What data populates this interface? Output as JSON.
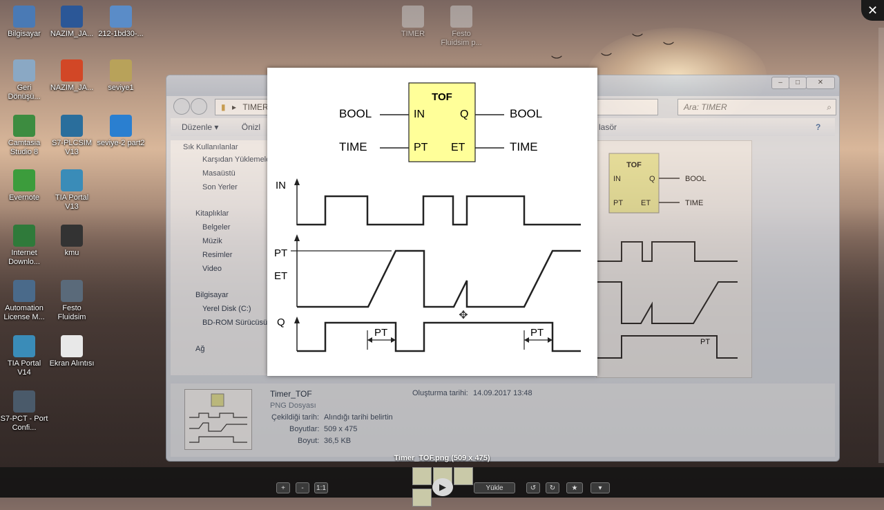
{
  "desktop": {
    "icons": [
      {
        "label": "Bilgisayar",
        "icon": "computer-icon",
        "color": "#4a7ab5"
      },
      {
        "label": "NAZIM_JA...",
        "icon": "word-doc-icon",
        "color": "#2b5797"
      },
      {
        "label": "212-1bd30-...",
        "icon": "document-icon",
        "color": "#5a8cc8"
      },
      {
        "label": "TIMER",
        "icon": "folder-icon",
        "color": "#c8c8c8"
      },
      {
        "label": "Festo Fluidsim p...",
        "icon": "folder-icon",
        "color": "#c8c8c8"
      },
      {
        "label": "Geri Dönüşü...",
        "icon": "recycle-bin-icon",
        "color": "#8aa8c4"
      },
      {
        "label": "NAZIM_JA...",
        "icon": "pdf-icon",
        "color": "#d24726"
      },
      {
        "label": "seviye1",
        "icon": "archive-icon",
        "color": "#b8a25a"
      },
      {
        "label": "Camtasia Studio 8",
        "icon": "camtasia-icon",
        "color": "#3d8c40"
      },
      {
        "label": "S7-PLCSIM V13",
        "icon": "plcsim-icon",
        "color": "#2a6e9c"
      },
      {
        "label": "seviye-2 part2",
        "icon": "lightning-icon",
        "color": "#2a7fd0"
      },
      {
        "label": "Evernote",
        "icon": "evernote-icon",
        "color": "#3c9c3c"
      },
      {
        "label": "TIA Portal V13",
        "icon": "tia-portal-icon",
        "color": "#3a8cb8"
      },
      {
        "label": "Internet Downlo...",
        "icon": "internet-download-icon",
        "color": "#2f7a3a"
      },
      {
        "label": "kmu",
        "icon": "image-icon",
        "color": "#333333"
      },
      {
        "label": "Automation License M...",
        "icon": "license-icon",
        "color": "#4a6a8a"
      },
      {
        "label": "Festo Fluidsim",
        "icon": "fluidsim-icon",
        "color": "#5a6a7a"
      },
      {
        "label": "TIA Portal V14",
        "icon": "tia-portal-icon",
        "color": "#3a8cb8"
      },
      {
        "label": "Ekran Alıntısı",
        "icon": "snipping-tool-icon",
        "color": "#e8e8e8"
      },
      {
        "label": "S7-PCT - Port Confi...",
        "icon": "s7-pct-icon",
        "color": "#4a5a6a"
      }
    ]
  },
  "explorer": {
    "address": "TIMER",
    "search_placeholder": "Ara: TIMER",
    "toolbar": {
      "organize": "Düzenle",
      "preview": "Önizl",
      "slideshow": "lasör"
    },
    "sidebar": {
      "favorites_header": "Sık Kullanılanlar",
      "favorites": [
        "Karşıdan Yüklemeler",
        "Masaüstü",
        "Son Yerler"
      ],
      "libraries_header": "Kitaplıklar",
      "libraries": [
        "Belgeler",
        "Müzik",
        "Resimler",
        "Video"
      ],
      "computer_header": "Bilgisayar",
      "computer": [
        "Yerel Disk (C:)",
        "BD-ROM Sürücüsü"
      ],
      "network": "Ağ"
    },
    "details": {
      "filename": "Timer_TOF",
      "filetype": "PNG Dosyası",
      "date_taken_label": "Çekildiği tarih:",
      "date_taken_value": "Alındığı tarihi belirtin",
      "dimensions_label": "Boyutlar:",
      "dimensions_value": "509 x 475",
      "size_label": "Boyut:",
      "size_value": "36,5 KB",
      "created_label": "Oluşturma tarihi:",
      "created_value": "14.09.2017 13:48"
    },
    "preview_pane": {
      "block_title": "TOF",
      "in": "IN",
      "pt": "PT",
      "q": "Q",
      "et": "ET",
      "bool": "BOOL",
      "time": "TIME",
      "pt_marker": "PT"
    }
  },
  "viewer": {
    "block_title": "TOF",
    "input_in": "IN",
    "input_pt": "PT",
    "output_q": "Q",
    "output_et": "ET",
    "left_in_type": "BOOL",
    "left_pt_type": "TIME",
    "right_q_type": "BOOL",
    "right_et_type": "TIME",
    "block_color": "#ffff99",
    "timing": {
      "in_label": "IN",
      "pt_label": "PT",
      "et_label": "ET",
      "q_label": "Q",
      "pt_marker_1": "PT",
      "pt_marker_2": "PT"
    }
  },
  "bottombar": {
    "caption": "Timer_TOF.png (509 x 475)",
    "zoom_in": "+",
    "zoom_out": "-",
    "actual_size": "1:1",
    "upload": "Yükle",
    "rotate_left": "↺",
    "rotate_right": "↻",
    "favorite": "★",
    "more": "▾",
    "play": "▶"
  },
  "close_button": "✕"
}
